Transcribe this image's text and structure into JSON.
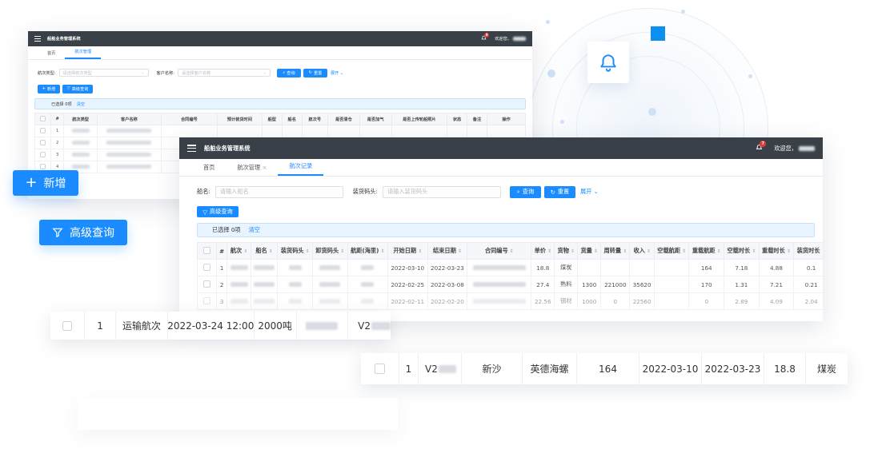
{
  "colors": {
    "accent": "#1a8cff",
    "topbar": "#3a4048",
    "badge": "#e53935"
  },
  "back": {
    "title": "船舶业务管理系统",
    "badge": "8",
    "welcome": "欢迎您，",
    "tabs": [
      "首页",
      "航次管理"
    ],
    "filters": {
      "voyage_type_label": "航次类型:",
      "voyage_type_placeholder": "请选择航次类型",
      "customer_label": "客户名称:",
      "customer_placeholder": "请选择客户名称"
    },
    "search_label": "查询",
    "reset_label": "重置",
    "expand_label": "展开",
    "add_label": "新增",
    "advanced_label": "高级查询",
    "selected_text": "已选择 0项",
    "clear_label": "清空",
    "columns": [
      "#",
      "航次类型",
      "客户名称",
      "合同编号",
      "预计装货时间",
      "船型",
      "船名",
      "航次号",
      "是否清仓",
      "是否加气",
      "是否上传轮船照片",
      "状态",
      "备注",
      "操作"
    ],
    "rows": [
      [
        "1"
      ],
      [
        "2"
      ],
      [
        "3"
      ],
      [
        "4"
      ]
    ]
  },
  "front": {
    "title": "船舶业务管理系统",
    "badge": "7",
    "welcome": "欢迎您，",
    "tabs": [
      "首页",
      "航次管理",
      "航次记录"
    ],
    "filters": {
      "ship_label": "船名:",
      "ship_placeholder": "请输入船名",
      "port_label": "装货码头:",
      "port_placeholder": "请输入装货码头"
    },
    "search_label": "查询",
    "reset_label": "重置",
    "expand_label": "展开",
    "advanced_label": "高级查询",
    "selected_text": "已选择 0项",
    "clear_label": "清空",
    "columns": [
      "#",
      "航次",
      "船名",
      "装货码头",
      "卸货码头",
      "航距(海里)",
      "开始日期",
      "结束日期",
      "合同编号",
      "单价",
      "货物",
      "货量",
      "周转量",
      "收入",
      "空载航距",
      "重载航距",
      "空载时长",
      "重载时长",
      "装货时长"
    ],
    "rows": [
      [
        "1",
        "",
        "",
        "",
        "",
        "",
        "2022-03-10",
        "2022-03-23",
        "",
        "18.8",
        "煤炭",
        "",
        "",
        "",
        "",
        "164",
        "7.18",
        "4.88",
        "0.1"
      ],
      [
        "2",
        "",
        "",
        "",
        "",
        "",
        "2022-02-25",
        "2022-03-08",
        "",
        "27.4",
        "熟料",
        "1300",
        "221000",
        "35620",
        "",
        "170",
        "1.31",
        "7.21",
        "0.21"
      ],
      [
        "3",
        "",
        "",
        "",
        "",
        "",
        "2022-02-11",
        "2022-02-20",
        "",
        "22.56",
        "钢材",
        "1000",
        "0",
        "22560",
        "",
        "0",
        "2.89",
        "4.09",
        "2.04"
      ]
    ]
  },
  "float_add_label": "新增",
  "float_advanced_label": "高级查询",
  "float_row1": {
    "index": "1",
    "type": "运输航次",
    "time": "2022-03-24 12:00",
    "weight": "2000吨",
    "code": "V2"
  },
  "float_row2": {
    "index": "1",
    "code": "V2",
    "from": "新沙",
    "to": "英德海螺",
    "distance": "164",
    "start": "2022-03-10",
    "end": "2022-03-23",
    "price": "18.8",
    "cargo": "煤炭"
  }
}
